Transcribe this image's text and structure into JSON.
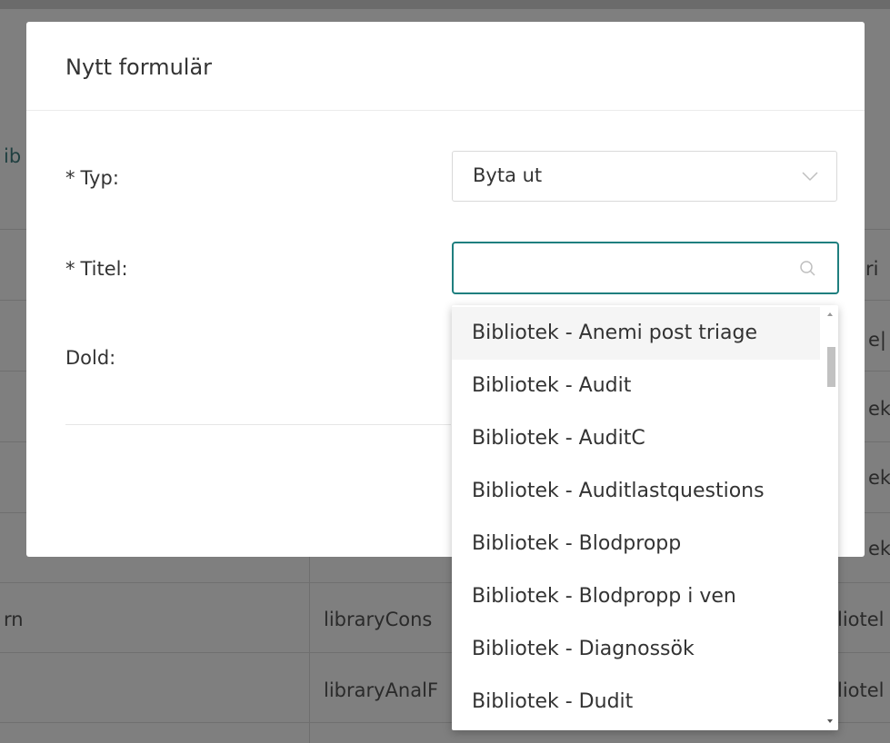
{
  "background": {
    "fragments": [
      {
        "text": "ib",
        "dark": true
      },
      {
        "text": "ri",
        "dark": false
      },
      {
        "text": "e|",
        "dark": false
      },
      {
        "text": "ek",
        "dark": false
      },
      {
        "text": "ek",
        "dark": false
      },
      {
        "text": "ek",
        "dark": false
      },
      {
        "text": "rn",
        "dark": false
      },
      {
        "text": "libraryCons",
        "dark": false
      },
      {
        "text": "liotel",
        "dark": false
      },
      {
        "text": "libraryAnalF",
        "dark": false
      },
      {
        "text": "liotel",
        "dark": false
      }
    ]
  },
  "modal": {
    "title": "Nytt formulär",
    "fields": {
      "type": {
        "required": "*",
        "label": "Typ:",
        "value": "Byta ut"
      },
      "title": {
        "required": "*",
        "label": "Titel:",
        "value": ""
      },
      "hidden": {
        "label": "Dold:"
      }
    }
  },
  "dropdown": {
    "options": [
      "Bibliotek - Anemi post triage",
      "Bibliotek - Audit",
      "Bibliotek - AuditC",
      "Bibliotek - Auditlastquestions",
      "Bibliotek - Blodpropp",
      "Bibliotek - Blodpropp i ven",
      "Bibliotek - Diagnossök",
      "Bibliotek - Dudit"
    ],
    "active_index": 0
  },
  "colors": {
    "accent": "#1f7f7f",
    "overlay": "#7f7f7f"
  }
}
